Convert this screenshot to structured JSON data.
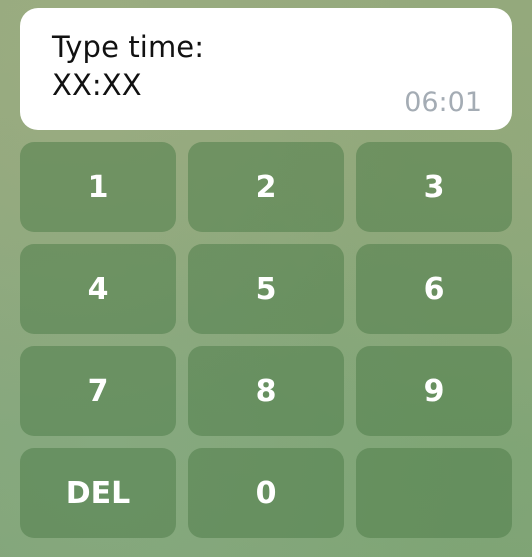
{
  "message": {
    "line1": "Type time:",
    "line2": "XX:XX",
    "timestamp": "06:01"
  },
  "keypad": {
    "keys": [
      "1",
      "2",
      "3",
      "4",
      "5",
      "6",
      "7",
      "8",
      "9",
      "DEL",
      "0",
      ""
    ]
  },
  "colors": {
    "bubble_bg": "#ffffff",
    "timestamp": "#a4acb4",
    "key_text": "#ffffff",
    "wallpaper": "#8aa67d"
  }
}
